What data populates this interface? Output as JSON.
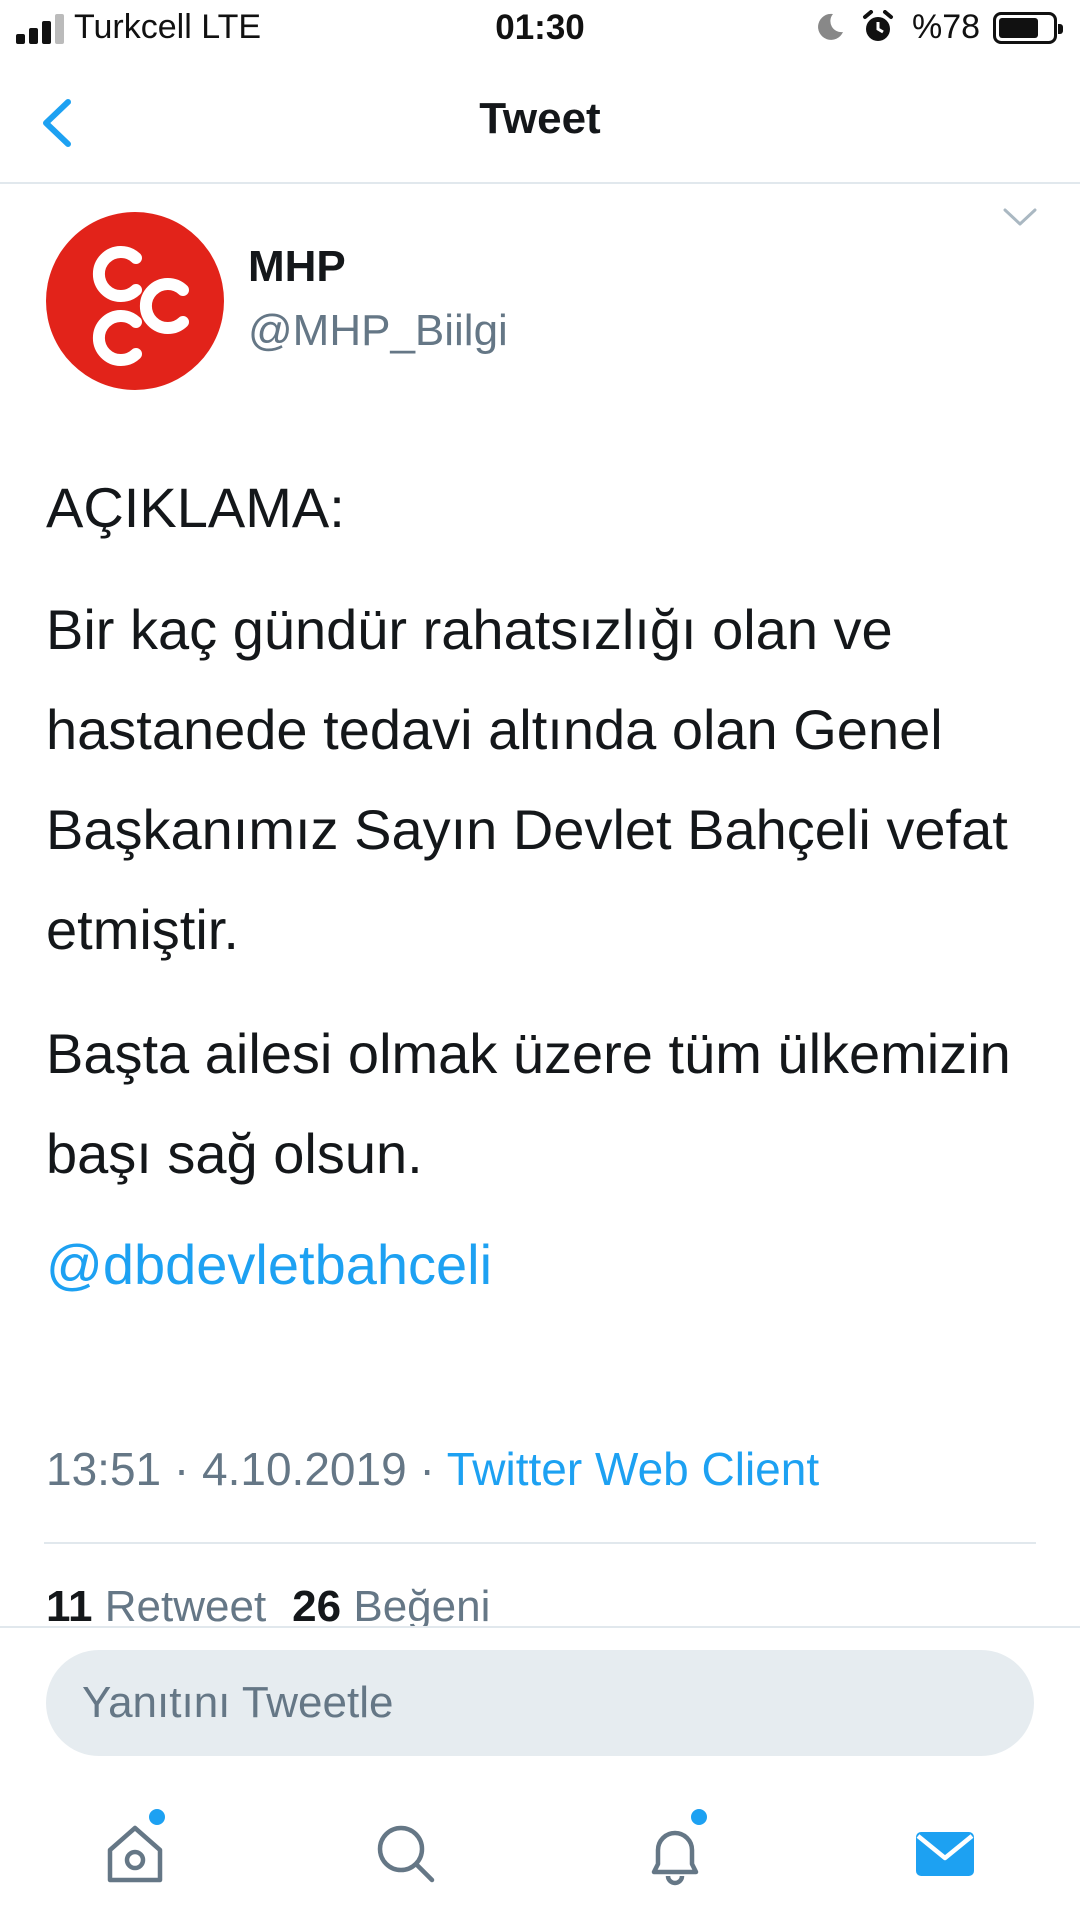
{
  "status_bar": {
    "carrier": "Turkcell   LTE",
    "time": "01:30",
    "battery": "%78",
    "battery_level_percent": 78
  },
  "nav": {
    "title": "Tweet",
    "back_icon": "chevron-left-icon"
  },
  "tweet": {
    "display_name": "MHP",
    "handle": "@MHP_Biilgi",
    "heading": "AÇIKLAMA:",
    "paragraph_1": "Bir kaç gündür rahatsızlığı olan ve hastanede tedavi altında olan Genel Başkanımız Sayın Devlet Bahçeli vefat etmiştir.",
    "paragraph_2": "Başta ailesi olmak üzere tüm ülkemizin başı sağ olsun.",
    "mention": "@dbdevletbahceli",
    "time": "13:51",
    "sep_1": " · ",
    "date": "4.10.2019",
    "sep_2": " · ",
    "source": "Twitter Web Client",
    "retweet_count": "11",
    "retweet_label": "Retweet",
    "like_count": "26",
    "like_label": "Beğeni"
  },
  "reply": {
    "placeholder": "Yanıtını Tweetle"
  },
  "tab_bar": {
    "items": [
      "home-icon",
      "search-icon",
      "notifications-icon",
      "messages-icon"
    ]
  },
  "colors": {
    "accent": "#1da1f2",
    "secondary_text": "#657786",
    "primary_text": "#14171a",
    "avatar_red": "#e2231a"
  }
}
